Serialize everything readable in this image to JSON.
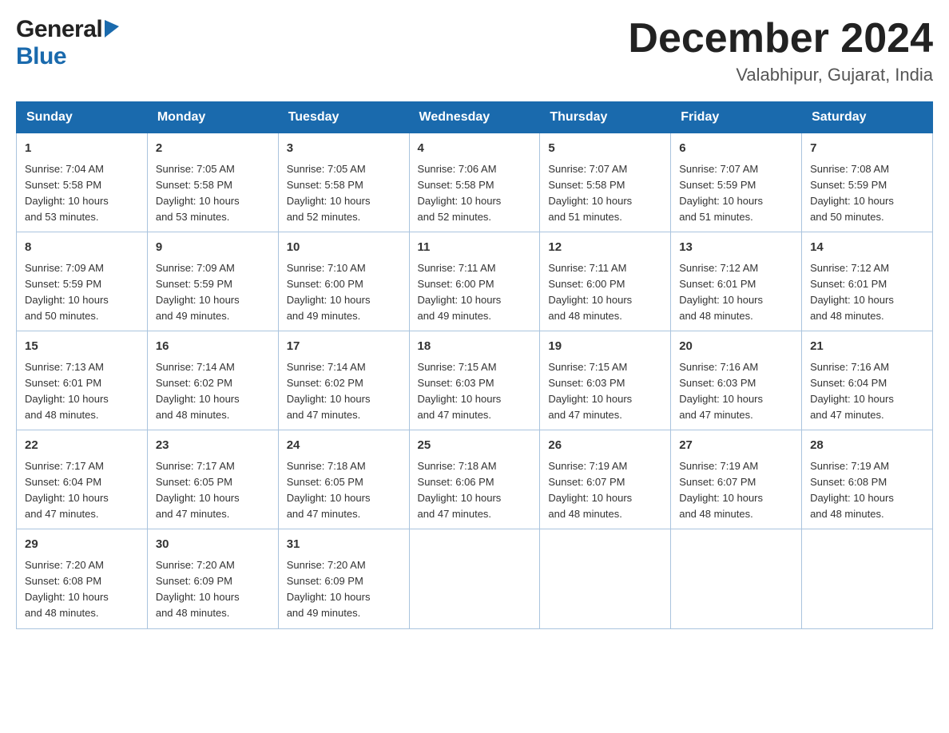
{
  "header": {
    "logo_general": "General",
    "logo_blue": "Blue",
    "month_title": "December 2024",
    "location": "Valabhipur, Gujarat, India"
  },
  "days_of_week": [
    "Sunday",
    "Monday",
    "Tuesday",
    "Wednesday",
    "Thursday",
    "Friday",
    "Saturday"
  ],
  "weeks": [
    [
      {
        "day": "1",
        "sunrise": "7:04 AM",
        "sunset": "5:58 PM",
        "daylight": "10 hours and 53 minutes."
      },
      {
        "day": "2",
        "sunrise": "7:05 AM",
        "sunset": "5:58 PM",
        "daylight": "10 hours and 53 minutes."
      },
      {
        "day": "3",
        "sunrise": "7:05 AM",
        "sunset": "5:58 PM",
        "daylight": "10 hours and 52 minutes."
      },
      {
        "day": "4",
        "sunrise": "7:06 AM",
        "sunset": "5:58 PM",
        "daylight": "10 hours and 52 minutes."
      },
      {
        "day": "5",
        "sunrise": "7:07 AM",
        "sunset": "5:58 PM",
        "daylight": "10 hours and 51 minutes."
      },
      {
        "day": "6",
        "sunrise": "7:07 AM",
        "sunset": "5:59 PM",
        "daylight": "10 hours and 51 minutes."
      },
      {
        "day": "7",
        "sunrise": "7:08 AM",
        "sunset": "5:59 PM",
        "daylight": "10 hours and 50 minutes."
      }
    ],
    [
      {
        "day": "8",
        "sunrise": "7:09 AM",
        "sunset": "5:59 PM",
        "daylight": "10 hours and 50 minutes."
      },
      {
        "day": "9",
        "sunrise": "7:09 AM",
        "sunset": "5:59 PM",
        "daylight": "10 hours and 49 minutes."
      },
      {
        "day": "10",
        "sunrise": "7:10 AM",
        "sunset": "6:00 PM",
        "daylight": "10 hours and 49 minutes."
      },
      {
        "day": "11",
        "sunrise": "7:11 AM",
        "sunset": "6:00 PM",
        "daylight": "10 hours and 49 minutes."
      },
      {
        "day": "12",
        "sunrise": "7:11 AM",
        "sunset": "6:00 PM",
        "daylight": "10 hours and 48 minutes."
      },
      {
        "day": "13",
        "sunrise": "7:12 AM",
        "sunset": "6:01 PM",
        "daylight": "10 hours and 48 minutes."
      },
      {
        "day": "14",
        "sunrise": "7:12 AM",
        "sunset": "6:01 PM",
        "daylight": "10 hours and 48 minutes."
      }
    ],
    [
      {
        "day": "15",
        "sunrise": "7:13 AM",
        "sunset": "6:01 PM",
        "daylight": "10 hours and 48 minutes."
      },
      {
        "day": "16",
        "sunrise": "7:14 AM",
        "sunset": "6:02 PM",
        "daylight": "10 hours and 48 minutes."
      },
      {
        "day": "17",
        "sunrise": "7:14 AM",
        "sunset": "6:02 PM",
        "daylight": "10 hours and 47 minutes."
      },
      {
        "day": "18",
        "sunrise": "7:15 AM",
        "sunset": "6:03 PM",
        "daylight": "10 hours and 47 minutes."
      },
      {
        "day": "19",
        "sunrise": "7:15 AM",
        "sunset": "6:03 PM",
        "daylight": "10 hours and 47 minutes."
      },
      {
        "day": "20",
        "sunrise": "7:16 AM",
        "sunset": "6:03 PM",
        "daylight": "10 hours and 47 minutes."
      },
      {
        "day": "21",
        "sunrise": "7:16 AM",
        "sunset": "6:04 PM",
        "daylight": "10 hours and 47 minutes."
      }
    ],
    [
      {
        "day": "22",
        "sunrise": "7:17 AM",
        "sunset": "6:04 PM",
        "daylight": "10 hours and 47 minutes."
      },
      {
        "day": "23",
        "sunrise": "7:17 AM",
        "sunset": "6:05 PM",
        "daylight": "10 hours and 47 minutes."
      },
      {
        "day": "24",
        "sunrise": "7:18 AM",
        "sunset": "6:05 PM",
        "daylight": "10 hours and 47 minutes."
      },
      {
        "day": "25",
        "sunrise": "7:18 AM",
        "sunset": "6:06 PM",
        "daylight": "10 hours and 47 minutes."
      },
      {
        "day": "26",
        "sunrise": "7:19 AM",
        "sunset": "6:07 PM",
        "daylight": "10 hours and 48 minutes."
      },
      {
        "day": "27",
        "sunrise": "7:19 AM",
        "sunset": "6:07 PM",
        "daylight": "10 hours and 48 minutes."
      },
      {
        "day": "28",
        "sunrise": "7:19 AM",
        "sunset": "6:08 PM",
        "daylight": "10 hours and 48 minutes."
      }
    ],
    [
      {
        "day": "29",
        "sunrise": "7:20 AM",
        "sunset": "6:08 PM",
        "daylight": "10 hours and 48 minutes."
      },
      {
        "day": "30",
        "sunrise": "7:20 AM",
        "sunset": "6:09 PM",
        "daylight": "10 hours and 48 minutes."
      },
      {
        "day": "31",
        "sunrise": "7:20 AM",
        "sunset": "6:09 PM",
        "daylight": "10 hours and 49 minutes."
      },
      null,
      null,
      null,
      null
    ]
  ],
  "labels": {
    "sunrise": "Sunrise:",
    "sunset": "Sunset:",
    "daylight": "Daylight:"
  }
}
